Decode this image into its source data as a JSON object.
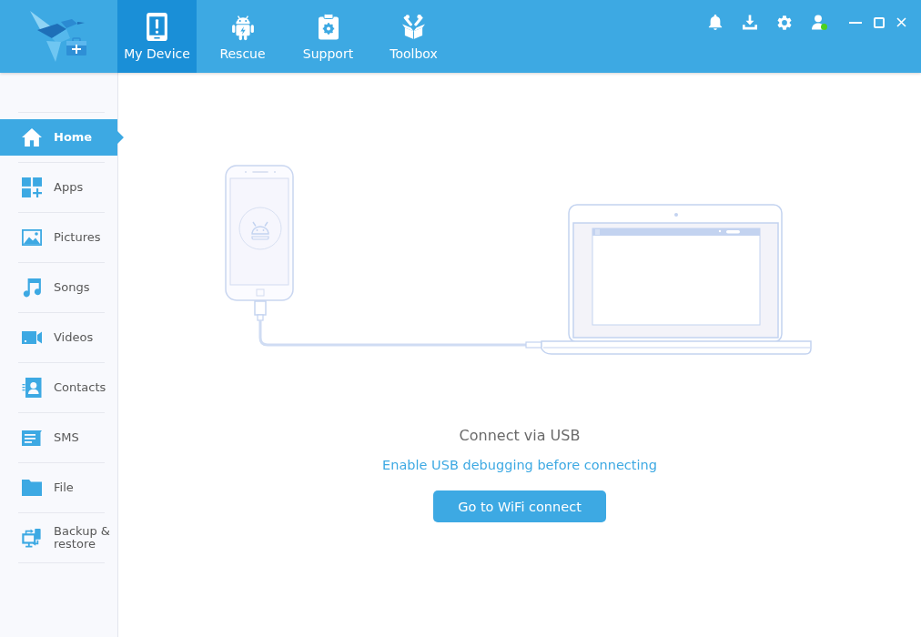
{
  "header": {
    "tabs": [
      {
        "label": "My Device",
        "selected": true
      },
      {
        "label": "Rescue",
        "selected": false
      },
      {
        "label": "Support",
        "selected": false
      },
      {
        "label": "Toolbox",
        "selected": false
      }
    ],
    "account_online": true
  },
  "sidebar": {
    "items": [
      {
        "label": "Home",
        "selected": true
      },
      {
        "label": "Apps",
        "selected": false
      },
      {
        "label": "Pictures",
        "selected": false
      },
      {
        "label": "Songs",
        "selected": false
      },
      {
        "label": "Videos",
        "selected": false
      },
      {
        "label": "Contacts",
        "selected": false
      },
      {
        "label": "SMS",
        "selected": false
      },
      {
        "label": "File",
        "selected": false
      },
      {
        "label": "Backup & restore",
        "selected": false
      }
    ]
  },
  "main": {
    "title": "Connect via USB",
    "link": "Enable USB debugging before connecting",
    "button": "Go to WiFi connect"
  }
}
